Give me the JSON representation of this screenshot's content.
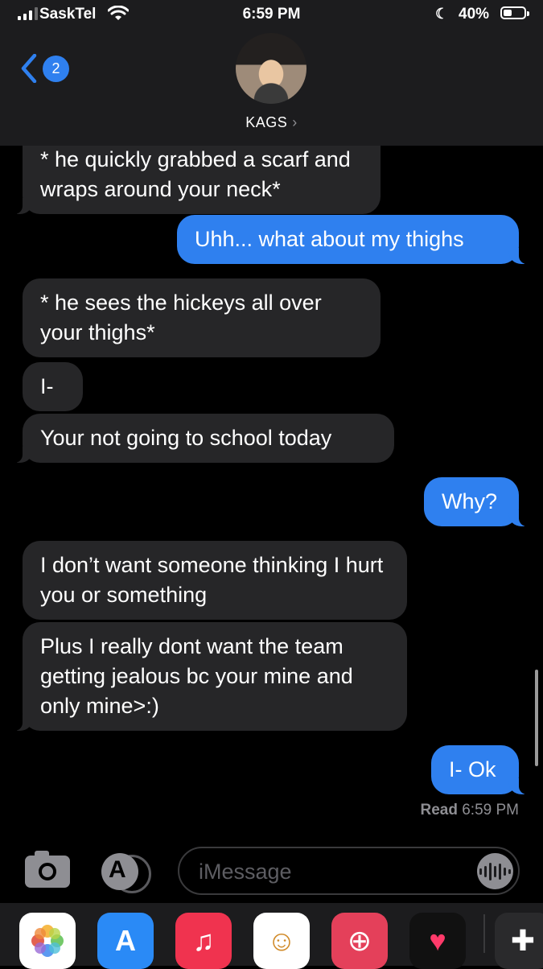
{
  "status_bar": {
    "carrier": "SaskTel",
    "time": "6:59 PM",
    "battery_percent": "40%",
    "battery_level": 0.4
  },
  "header": {
    "back_badge": "2",
    "contact_name": "KAGS",
    "contact_chevron": "›"
  },
  "messages": [
    {
      "from": "them",
      "text": "* he quickly grabbed a scarf and wraps around your neck*"
    },
    {
      "from": "me",
      "text": "Uhh... what about my thighs"
    },
    {
      "from": "them",
      "text": "* he sees the hickeys all over your thighs*"
    },
    {
      "from": "them",
      "text": "I-"
    },
    {
      "from": "them",
      "text": "Your not going to school today"
    },
    {
      "from": "me",
      "text": "Why?"
    },
    {
      "from": "them",
      "text": "I don’t want someone thinking I hurt you or something"
    },
    {
      "from": "them",
      "text": "Plus I really dont want the team getting jealous bc your mine and only mine>:)"
    },
    {
      "from": "me",
      "text": "I- Ok"
    }
  ],
  "read_receipt": {
    "label": "Read",
    "time": "6:59 PM"
  },
  "input_bar": {
    "placeholder": "iMessage"
  },
  "app_drawer": {
    "icons": [
      "photos-icon",
      "app-store-icon",
      "music-icon",
      "memoji-icon",
      "search-web-icon",
      "digital-touch-icon",
      "game-icon"
    ]
  },
  "colors": {
    "outgoing_bubble": "#2f80ef",
    "incoming_bubble": "#262628",
    "header_bg": "#1c1c1e"
  }
}
